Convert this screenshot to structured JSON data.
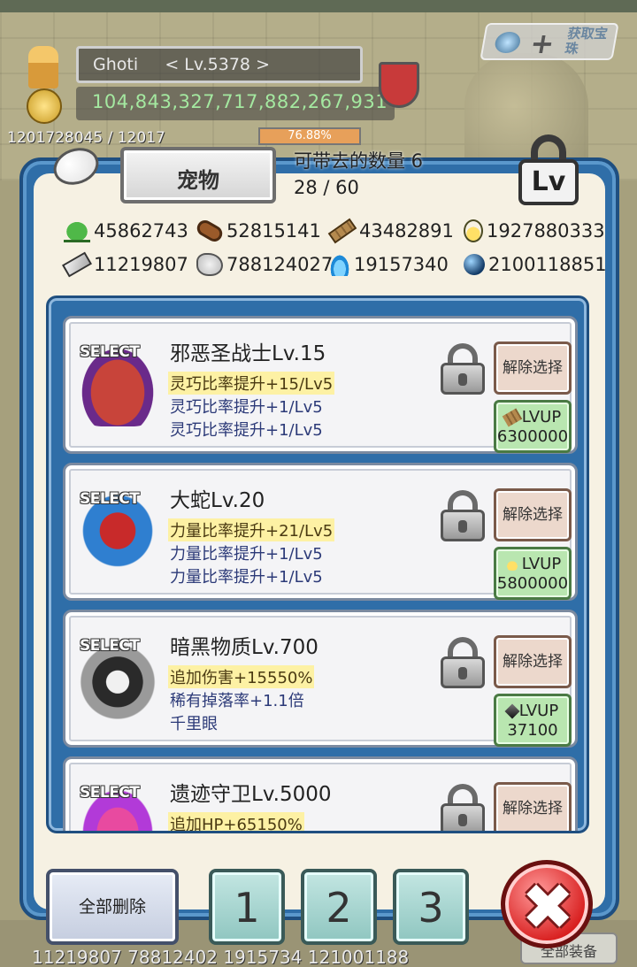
{
  "hud": {
    "player_name": "Ghoti     < Lv.5378 >",
    "gold": "104,843,327,717,882,267,931",
    "exp_text": "1201728045 / 12017",
    "exp_percent": "76.88%",
    "get_gem_label": "获取宝珠"
  },
  "dialog": {
    "title": "宠物",
    "carry_label": "可带去的数量 6",
    "carry_count": "28 / 60",
    "lock_icon_text": "Lv"
  },
  "resources": [
    {
      "icon": "herb-icon",
      "value": "45862743"
    },
    {
      "icon": "wood-log-icon",
      "value": "52815141"
    },
    {
      "icon": "plank-icon",
      "value": "43482891"
    },
    {
      "icon": "water-drop-icon",
      "value": "1927880333"
    },
    {
      "icon": "metal-bar-icon",
      "value": "11219807"
    },
    {
      "icon": "stone-icon",
      "value": "788124027"
    },
    {
      "icon": "blue-flame-icon",
      "value": "19157340"
    },
    {
      "icon": "dark-orb-icon",
      "value": "2100118851"
    }
  ],
  "pets": [
    {
      "select": "SELECT",
      "name": "邪恶圣战士Lv.15",
      "lines": [
        "灵巧比率提升+15/Lv5",
        "灵巧比率提升+1/Lv5",
        "灵巧比率提升+1/Lv5"
      ],
      "deselect_label": "解除选择",
      "lvup_label": "LVUP",
      "lvup_cost": "6300000",
      "cost_icon": "plank-icon",
      "colors": [
        "#c8443a",
        "#6a2a8a"
      ]
    },
    {
      "select": "SELECT",
      "name": "大蛇Lv.20",
      "lines": [
        "力量比率提升+21/Lv5",
        "力量比率提升+1/Lv5",
        "力量比率提升+1/Lv5"
      ],
      "deselect_label": "解除选择",
      "lvup_label": "LVUP",
      "lvup_cost": "5800000",
      "cost_icon": "water-drop-icon",
      "colors": [
        "#2f7fd0",
        "#c82a2a"
      ]
    },
    {
      "select": "SELECT",
      "name": "暗黑物质Lv.700",
      "lines": [
        "追加伤害+15550%",
        "稀有掉落率+1.1倍",
        "千里眼"
      ],
      "deselect_label": "解除选择",
      "lvup_label": "LVUP",
      "lvup_cost": "37100",
      "cost_icon": "dark-crystal-icon",
      "colors": [
        "#2a2a2a",
        "#9a9a9a"
      ]
    },
    {
      "select": "SELECT",
      "name": "遗迹守卫Lv.5000",
      "lines": [
        "追加HP+65150%"
      ],
      "deselect_label": "解除选择",
      "lvup_label": "",
      "lvup_cost": "",
      "cost_icon": "",
      "colors": [
        "#b23ad8",
        "#e84aa0"
      ]
    }
  ],
  "footer": {
    "delete_all_label": "全部删除",
    "slots": [
      "1",
      "2",
      "3"
    ],
    "close_symbol": "✖"
  },
  "background_strip": {
    "text": "11219807 78812402 1915734 121001188",
    "equip_label": "全部装备"
  }
}
